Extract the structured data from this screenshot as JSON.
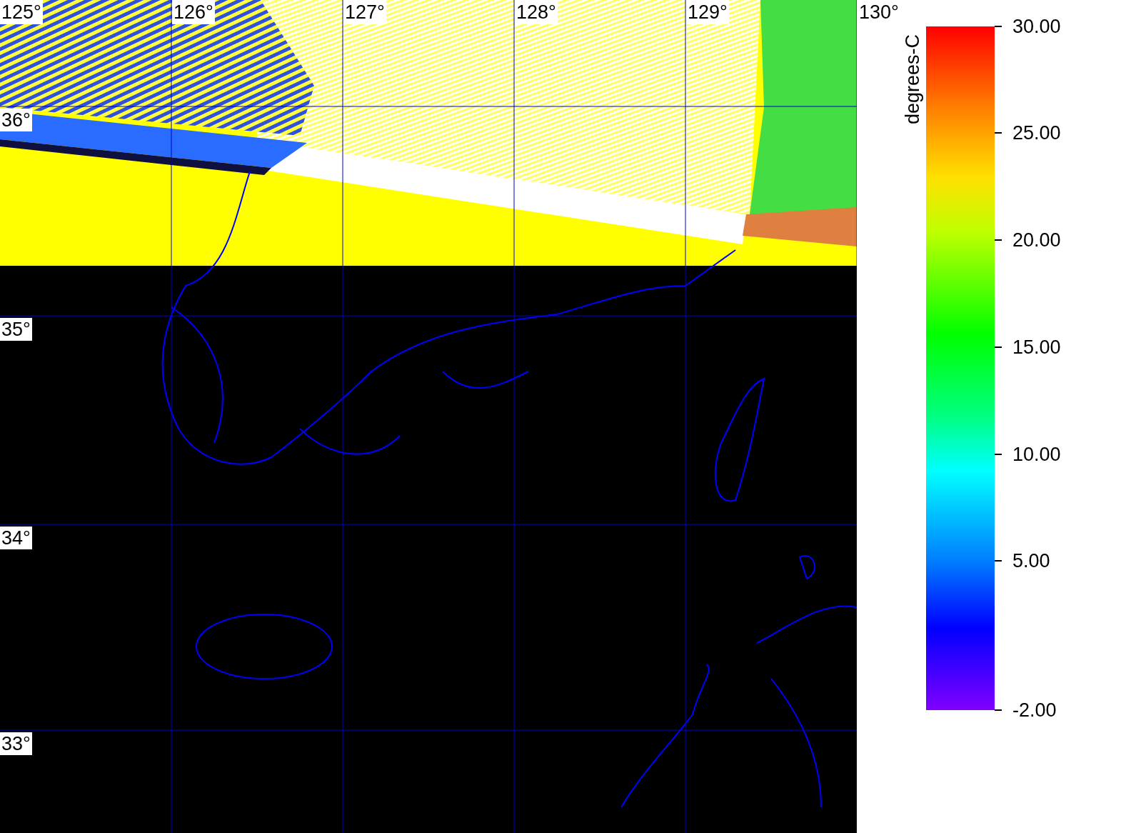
{
  "map": {
    "longitude_labels": [
      "125°",
      "126°",
      "127°",
      "128°",
      "129°",
      "130°"
    ],
    "latitude_labels": [
      "36°",
      "35°",
      "34°",
      "33°"
    ]
  },
  "colorbar": {
    "title": "degrees-C",
    "tick_labels": [
      "30.00",
      "25.00",
      "20.00",
      "15.00",
      "10.00",
      "5.00",
      "-2.00"
    ]
  }
}
